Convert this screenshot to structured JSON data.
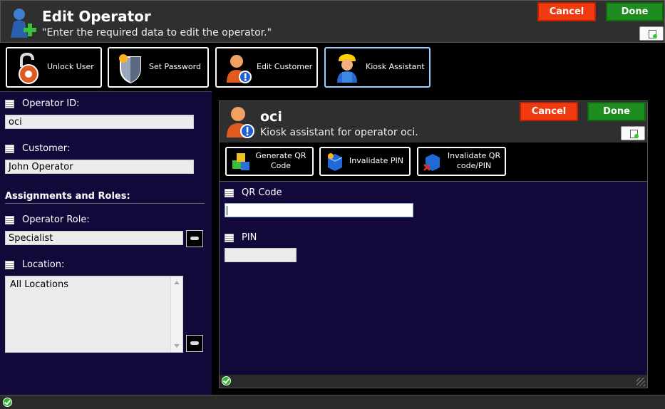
{
  "header": {
    "title": "Edit Operator",
    "subtitle": "\"Enter the required data to edit the operator.\"",
    "cancel_label": "Cancel",
    "done_label": "Done"
  },
  "toolbar": {
    "unlock_user": "Unlock User",
    "set_password": "Set Password",
    "edit_customer": "Edit Customer",
    "kiosk_assistant": "Kiosk Assistant"
  },
  "left": {
    "operator_id_label": "Operator ID:",
    "operator_id_value": "oci",
    "customer_label": "Customer:",
    "customer_value": "John Operator",
    "section_title": "Assignments and Roles:",
    "role_label": "Operator Role:",
    "role_value": "Specialist",
    "location_label": "Location:",
    "location_items": [
      "All Locations"
    ]
  },
  "kiosk": {
    "title": "oci",
    "subtitle": "Kiosk assistant for operator oci.",
    "cancel_label": "Cancel",
    "done_label": "Done",
    "generate_qr": "Generate QR Code",
    "invalidate_pin": "Invalidate PIN",
    "invalidate_qr": "Invalidate QR code/PIN",
    "qr_label": "QR Code",
    "qr_value": "",
    "pin_label": "PIN",
    "pin_value": ""
  },
  "colors": {
    "cancel": "#f03a10",
    "done": "#1e8c1e",
    "pane_bg": "#12093a"
  }
}
